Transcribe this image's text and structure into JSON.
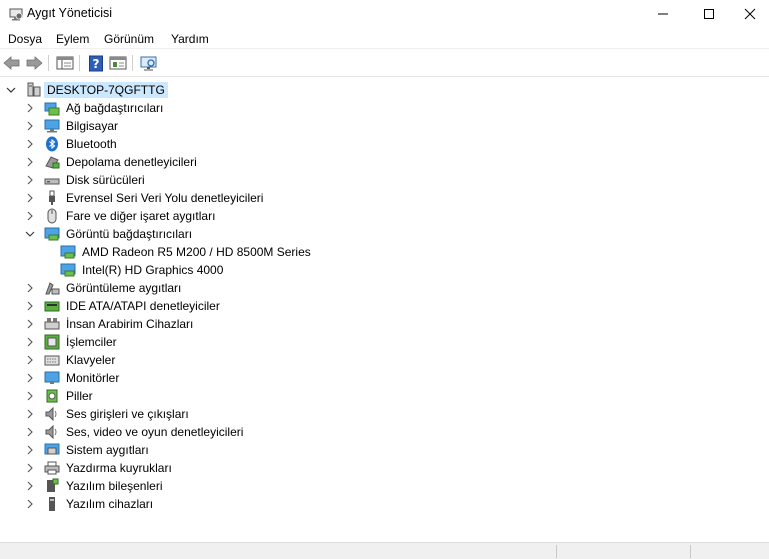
{
  "window": {
    "title": "Aygıt Yöneticisi"
  },
  "menu": {
    "items": [
      "Dosya",
      "Eylem",
      "Görünüm",
      "Yardım"
    ]
  },
  "tree": {
    "root": "DESKTOP-7QGFTTG",
    "categories": [
      {
        "label": "Ağ bağdaştırıcıları",
        "icon": "network-adapter-icon",
        "expanded": false
      },
      {
        "label": "Bilgisayar",
        "icon": "computer-icon",
        "expanded": false
      },
      {
        "label": "Bluetooth",
        "icon": "bluetooth-icon",
        "expanded": false
      },
      {
        "label": "Depolama denetleyicileri",
        "icon": "storage-controller-icon",
        "expanded": false
      },
      {
        "label": "Disk sürücüleri",
        "icon": "disk-drive-icon",
        "expanded": false
      },
      {
        "label": "Evrensel Seri Veri Yolu denetleyicileri",
        "icon": "usb-icon",
        "expanded": false
      },
      {
        "label": "Fare ve diğer işaret aygıtları",
        "icon": "mouse-icon",
        "expanded": false
      },
      {
        "label": "Görüntü bağdaştırıcıları",
        "icon": "display-adapter-icon",
        "expanded": true,
        "children": [
          {
            "label": "AMD Radeon R5 M200 / HD 8500M Series",
            "icon": "display-adapter-icon"
          },
          {
            "label": "Intel(R) HD Graphics 4000",
            "icon": "display-adapter-icon"
          }
        ]
      },
      {
        "label": "Görüntüleme aygıtları",
        "icon": "imaging-device-icon",
        "expanded": false
      },
      {
        "label": "IDE ATA/ATAPI denetleyiciler",
        "icon": "ide-controller-icon",
        "expanded": false
      },
      {
        "label": "İnsan Arabirim Cihazları",
        "icon": "hid-icon",
        "expanded": false
      },
      {
        "label": "İşlemciler",
        "icon": "processor-icon",
        "expanded": false
      },
      {
        "label": "Klavyeler",
        "icon": "keyboard-icon",
        "expanded": false
      },
      {
        "label": "Monitörler",
        "icon": "monitor-icon",
        "expanded": false
      },
      {
        "label": "Piller",
        "icon": "battery-icon",
        "expanded": false
      },
      {
        "label": "Ses girişleri ve çıkışları",
        "icon": "speaker-icon",
        "expanded": false
      },
      {
        "label": "Ses, video ve oyun denetleyicileri",
        "icon": "speaker-icon",
        "expanded": false
      },
      {
        "label": "Sistem aygıtları",
        "icon": "system-device-icon",
        "expanded": false
      },
      {
        "label": "Yazdırma kuyrukları",
        "icon": "printer-icon",
        "expanded": false
      },
      {
        "label": "Yazılım bileşenleri",
        "icon": "software-component-icon",
        "expanded": false
      },
      {
        "label": "Yazılım cihazları",
        "icon": "software-device-icon",
        "expanded": false
      }
    ]
  },
  "colors": {
    "selection": "#cce8ff",
    "accent": "#0078d7"
  }
}
